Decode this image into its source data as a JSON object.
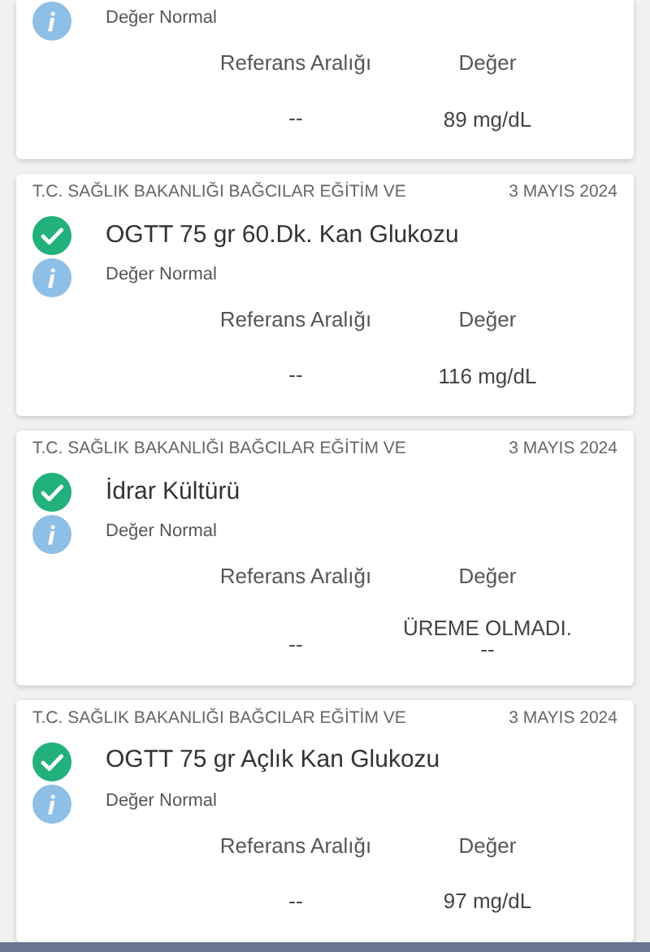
{
  "results": [
    {
      "note": "Değer Normal",
      "reference_label": "Referans Aralığı",
      "value_label": "Değer",
      "reference": "--",
      "value": [
        "89 mg/dL"
      ]
    },
    {
      "institution": "T.C. SAĞLIK BAKANLIĞI BAĞCILAR EĞİTİM VE",
      "date": "3 MAYIS 2024",
      "kind": "normal",
      "test": "OGTT 75 gr 60.Dk. Kan Glukozu",
      "note": "Değer Normal",
      "reference_label": "Referans Aralığı",
      "value_label": "Değer",
      "reference": "--",
      "value": [
        "116 mg/dL"
      ]
    },
    {
      "institution": "T.C. SAĞLIK BAKANLIĞI BAĞCILAR EĞİTİM VE",
      "date": "3 MAYIS 2024",
      "kind": "normal",
      "test": "İdrar Kültürü",
      "note": "Değer Normal",
      "reference_label": "Referans Aralığı",
      "value_label": "Değer",
      "reference": "--",
      "value": [
        "ÜREME OLMADI.",
        "--"
      ]
    },
    {
      "institution": "T.C. SAĞLIK BAKANLIĞI BAĞCILAR EĞİTİM VE",
      "date": "3 MAYIS 2024",
      "kind": "normal",
      "test": "OGTT 75 gr Açlık Kan Glukozu",
      "note": "Değer Normal",
      "reference_label": "Referans Aralığı",
      "value_label": "Değer",
      "reference": "--",
      "value": [
        "97 mg/dL"
      ]
    }
  ]
}
